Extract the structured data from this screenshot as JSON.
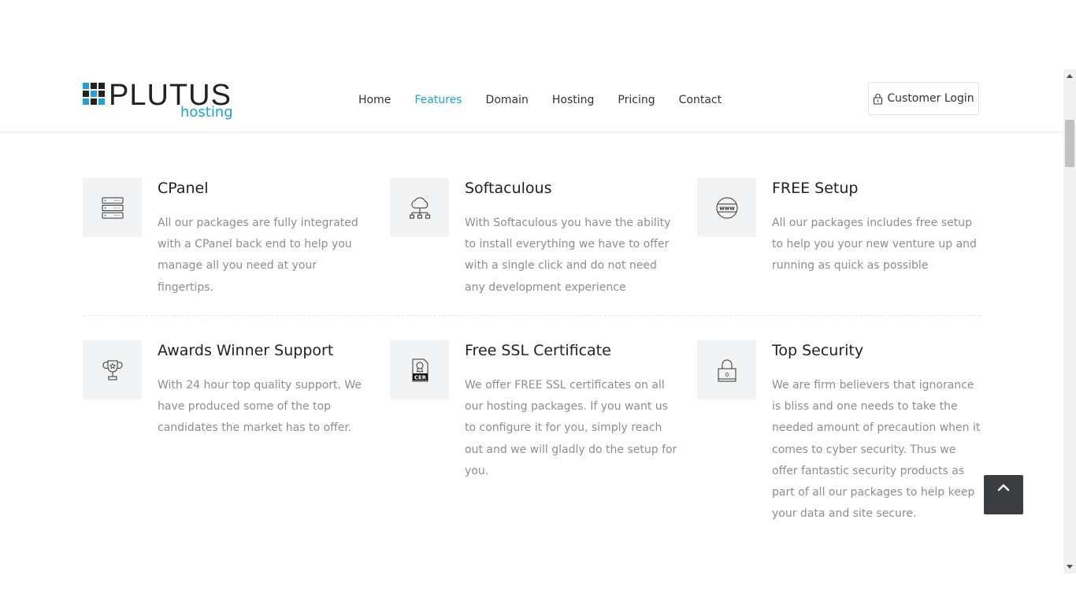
{
  "brand": {
    "name": "PLUTUS",
    "tagline": "hosting",
    "colors": {
      "accent": "#1fa1d6",
      "dark": "#222222"
    }
  },
  "nav": {
    "items": [
      {
        "label": "Home",
        "active": false
      },
      {
        "label": "Features",
        "active": true
      },
      {
        "label": "Domain",
        "active": false
      },
      {
        "label": "Hosting",
        "active": false
      },
      {
        "label": "Pricing",
        "active": false
      },
      {
        "label": "Contact",
        "active": false
      }
    ]
  },
  "login": {
    "label": "Customer Login",
    "icon": "lock-icon"
  },
  "features": [
    {
      "icon": "server-icon",
      "title": "CPanel",
      "text": "All our packages are fully integrated with a CPanel back end to help you manage all you need at your fingertips."
    },
    {
      "icon": "cloud-network-icon",
      "title": "Softaculous",
      "text": "With Softaculous you have the ability to install everything we have to offer with a single click and do not need any development experience"
    },
    {
      "icon": "www-globe-icon",
      "title": "FREE Setup",
      "text": "All our packages includes free setup to help you your new venture up and running as quick as possible"
    },
    {
      "icon": "trophy-icon",
      "title": "Awards Winner Support",
      "text": "With 24 hour top quality support. We have produced some of the top candidates the market has to offer."
    },
    {
      "icon": "certificate-icon",
      "cert_label": "CER",
      "title": "Free SSL Certificate",
      "text": "We offer FREE SSL certificates on all our hosting packages. If you want us to configure it for you, simply reach out and we will gladly do the setup for you."
    },
    {
      "icon": "padlock-icon",
      "lock_label": "0",
      "title": "Top Security",
      "text": "We are firm believers that ignorance is bliss and one needs to take the needed amount of precaution when it comes to cyber security. Thus we offer fantastic security products as part of all our packages to help keep your data and site secure."
    }
  ],
  "back_to_top": {
    "icon": "chevron-up-icon"
  }
}
